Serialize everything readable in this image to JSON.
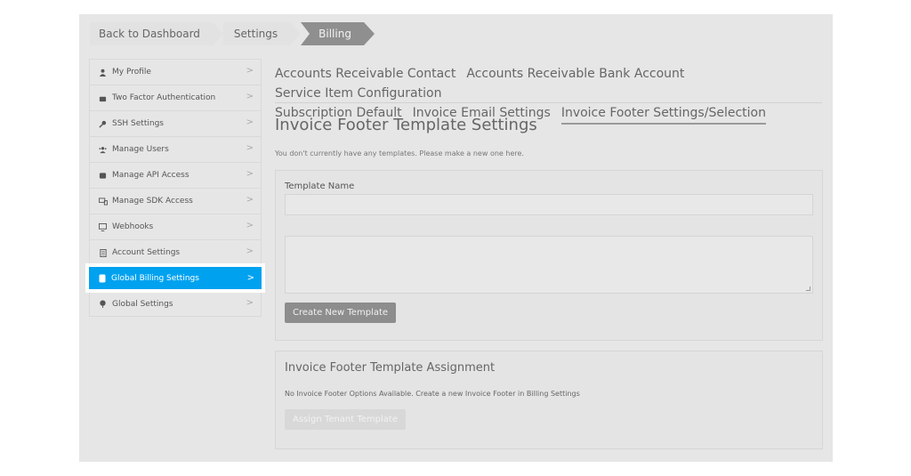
{
  "breadcrumb": {
    "back": "Back to Dashboard",
    "settings": "Settings",
    "current": "Billing"
  },
  "sidebar": {
    "items": [
      {
        "label": "My Profile",
        "icon": "person-icon"
      },
      {
        "label": "Two Factor Authentication",
        "icon": "phone-icon"
      },
      {
        "label": "SSH Settings",
        "icon": "key-icon"
      },
      {
        "label": "Manage Users",
        "icon": "users-icon"
      },
      {
        "label": "Manage API Access",
        "icon": "api-icon"
      },
      {
        "label": "Manage SDK Access",
        "icon": "devices-icon"
      },
      {
        "label": "Webhooks",
        "icon": "monitor-icon"
      },
      {
        "label": "Account Settings",
        "icon": "document-icon"
      },
      {
        "label": "Global Billing Settings",
        "icon": "billing-icon"
      },
      {
        "label": "Global Settings",
        "icon": "globe-icon"
      }
    ],
    "active_index": 8,
    "accent": "#00a2f0"
  },
  "tabs": [
    "Accounts Receivable Contact",
    "Accounts Receivable Bank Account",
    "Service Item Configuration",
    "Subscription Default",
    "Invoice Email Settings",
    "Invoice Footer Settings/Selection"
  ],
  "active_tab": 5,
  "page": {
    "title": "Invoice Footer Template Settings",
    "notice": "You don't currently have any templates. Please make a new one here."
  },
  "template_form": {
    "name_label": "Template Name",
    "name_value": "",
    "body_value": "",
    "create_button": "Create New Template"
  },
  "assignment": {
    "title": "Invoice Footer Template Assignment",
    "message": "No Invoice Footer Options Available. Create a new Invoice Footer in Billing Settings",
    "assign_button": "Assign Tenant Template"
  }
}
